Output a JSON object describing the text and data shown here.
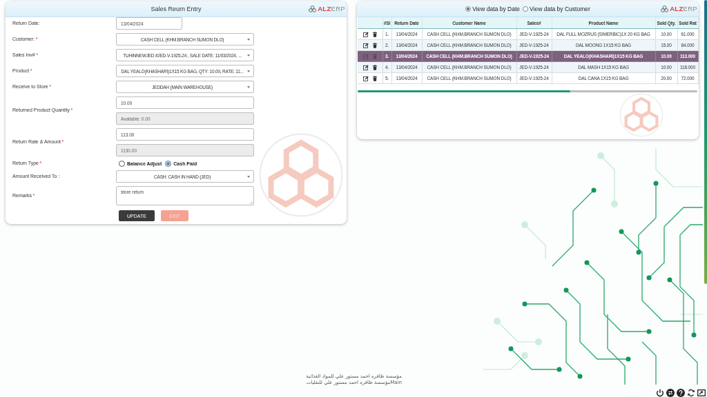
{
  "form": {
    "title": "Sales Reurn Entry",
    "logo": {
      "part_1": "ALZ",
      "part_2": "ERP"
    },
    "fields": [
      {
        "kind": "date",
        "label": "Return Date:",
        "value": "13/04/2024"
      },
      {
        "kind": "select",
        "label": "Customer:",
        "required_mark": "*",
        "value": "CASH CELL (KHM.BRANCH SUMON DLO)"
      },
      {
        "kind": "select",
        "label": "Sales Inv#",
        "required_mark": "*",
        "value": "TUHINNEWJED #JED-V-1925-24 , SALE DATE: 11/03/2024, ..."
      },
      {
        "kind": "select",
        "label": "Product",
        "required_mark": "*",
        "value": "DAL YEALO(KHASHARI)1X15 KG BAG, QTY: 10.00, RATE: 11..."
      },
      {
        "kind": "select",
        "label": "Receive to Store",
        "required_mark": "*",
        "value": "JEDDAH (MAIN WAREHOUSE)"
      },
      {
        "kind": "pair",
        "label": "Returned Product Quantity",
        "required_mark": "*",
        "inputs": [
          {
            "value": "10.00",
            "disabled": false
          },
          {
            "value": "Available: 0.00",
            "disabled": true
          }
        ]
      },
      {
        "kind": "pair",
        "label": "Return Rate & Amount",
        "required_mark": "*",
        "inputs": [
          {
            "value": "113.00",
            "disabled": false
          },
          {
            "value": "1130.00",
            "disabled": true
          }
        ]
      },
      {
        "kind": "radio",
        "label": "Return Type",
        "required_mark": "*",
        "options": [
          {
            "label": "Balance Adjust",
            "selected": false
          },
          {
            "label": "Cash Paid",
            "selected": true
          }
        ]
      },
      {
        "kind": "select",
        "label": "Amount Received To :",
        "value": "CASH: CASH IN HAND (JED)"
      },
      {
        "kind": "textarea",
        "label": "Remarks",
        "required_mark": "*",
        "value": "store return"
      }
    ],
    "buttons": [
      {
        "label": "UPDATE",
        "kind": "primary",
        "disabled": false
      },
      {
        "label": "EXIT",
        "kind": "danger",
        "disabled": true
      }
    ]
  },
  "records": {
    "view_options": [
      {
        "label": "View data by Date",
        "selected": true
      },
      {
        "label": "View data by Customer",
        "selected": false
      }
    ],
    "logo": {
      "part_1": "ALZ",
      "part_2": "ERP"
    },
    "table": {
      "columns": [
        "#Sl",
        "Return Date",
        "Customer Name",
        "Sales#",
        "Product Name",
        "Sold Qty.",
        "Sold Rat"
      ],
      "rows": [
        {
          "selected": false,
          "cells": [
            "1.",
            "13/04/2024",
            "CASH CELL (KHM.BRANCH SUMON DLO)",
            "JED-V-1925-24",
            "DAL FULL MOZRUS (SIMERBIC)1X 20 KG BAG",
            "10.00",
            "61.000"
          ]
        },
        {
          "selected": false,
          "cells": [
            "2.",
            "13/04/2024",
            "CASH CELL (KHM.BRANCH SUMON DLO)",
            "JED-V-1925-24",
            "DAL MOONG 1X15 KG BAG",
            "15.00",
            "84.000"
          ]
        },
        {
          "selected": true,
          "cells": [
            "3.",
            "13/04/2024",
            "CASH CELL (KHM.BRANCH SUMON DLO)",
            "JED-V-1925-24",
            "DAL YEALO(KHASHARI)1X15 KG BAG",
            "10.00",
            "113.000"
          ]
        },
        {
          "selected": false,
          "cells": [
            "4.",
            "13/04/2024",
            "CASH CELL (KHM.BRANCH SUMON DLO)",
            "JED-V-1925-24",
            "DAL MASH 1X15 KG BAG",
            "10.00",
            "118.000"
          ]
        },
        {
          "selected": false,
          "cells": [
            "5.",
            "13/04/2024",
            "CASH CELL (KHM.BRANCH SUMON DLO)",
            "JED-V-1925-24",
            "DAL CANA 1X15 KG BAG",
            "20.00",
            "72.000"
          ]
        }
      ]
    }
  },
  "footer": {
    "company_lines": [
      "مؤسسة ظافره احمد مستور علي للمواد الغذائية",
      "Mainمؤسسة ظافره احمد مستور علي للنقليات"
    ]
  }
}
